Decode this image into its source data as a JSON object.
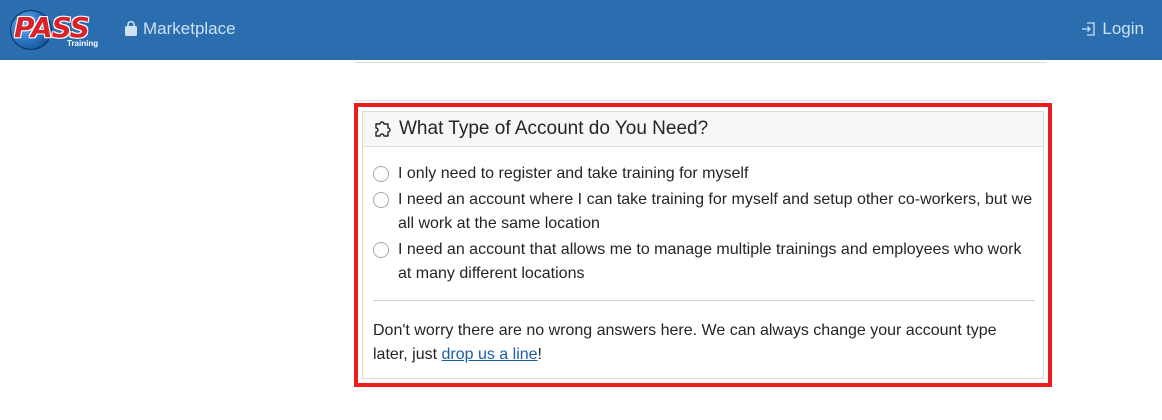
{
  "navbar": {
    "brand_text": "PASS",
    "brand_sub": "Training",
    "marketplace_label": "Marketplace",
    "marketplace_icon": "shopping-bag-icon",
    "login_label": "Login",
    "login_icon": "sign-in-icon",
    "bg_color": "#2a6eb0"
  },
  "card": {
    "title": "What Type of Account do You Need?",
    "title_icon": "puzzle-piece-icon",
    "highlight_color": "#ee1c1c",
    "options": [
      {
        "label": "I only need to register and take training for myself",
        "selected": false
      },
      {
        "label": "I need an account where I can take training for myself and setup other co-workers, but we all work at the same location",
        "selected": false
      },
      {
        "label": "I need an account that allows me to manage multiple trainings and employees who work at many different locations",
        "selected": false
      }
    ],
    "note_before": "Don't worry there are no wrong answers here. We can always change your account type later, just ",
    "note_link": "drop us a line",
    "note_after": "!"
  }
}
